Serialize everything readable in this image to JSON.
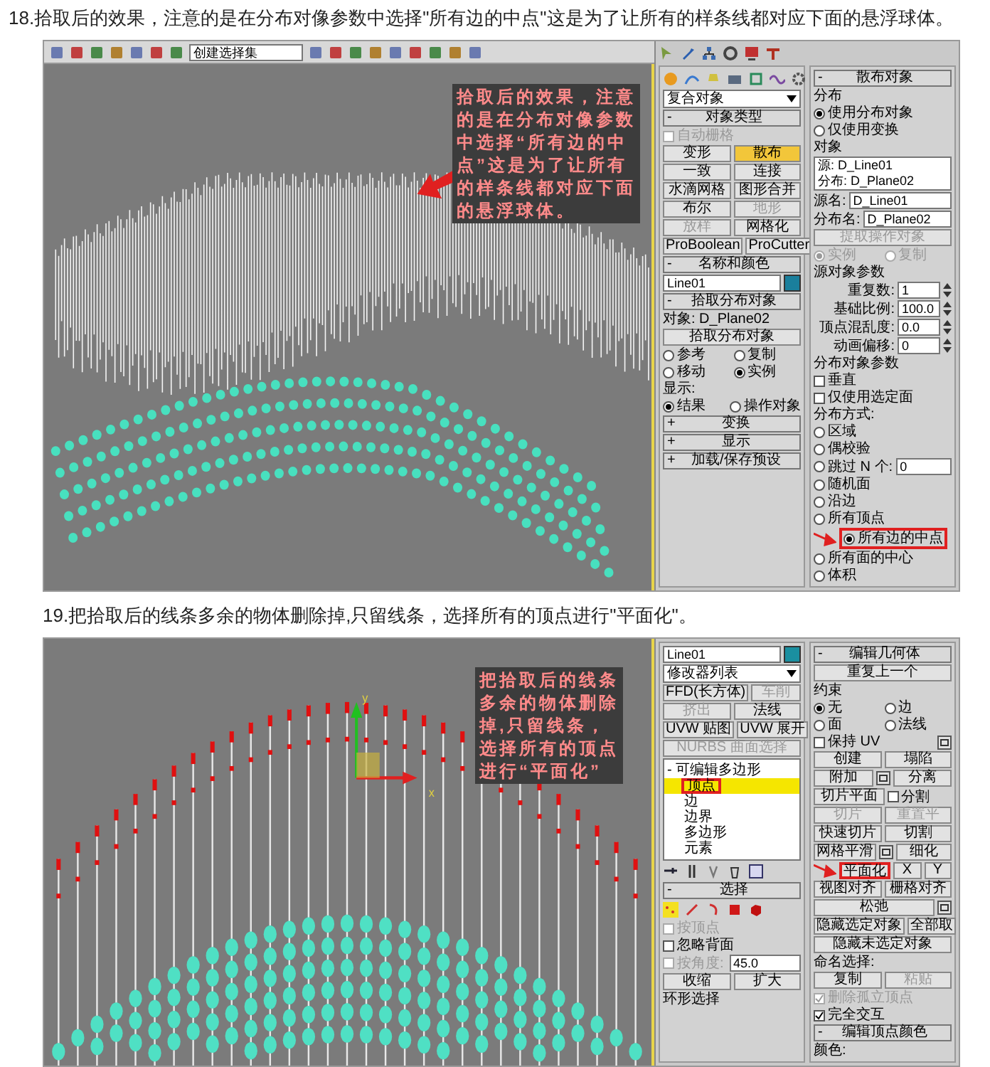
{
  "steps": [
    {
      "caption": "18.拾取后的效果，注意的是在分布对像参数中选择\"所有边的中点\"这是为了让所有的样条线都对应下面的悬浮球体。",
      "screenshot": {
        "toolbar": {
          "selection_set": "创建选择集"
        },
        "viewport": {
          "kind": "scatter",
          "annotation": [
            "拾取后的效果，注意",
            "的是在分布对像参数",
            "中选择“所有边的中",
            "点”这是为了让所有",
            "的样条线都对应下面",
            "的悬浮球体。"
          ]
        },
        "panel_top": [
          {
            "kind": "tabicons"
          }
        ],
        "columns": [
          {
            "rows": [
              [
                {
                  "kind": "createicons"
                }
              ],
              [
                {
                  "kind": "dropdown",
                  "value": "复合对象"
                }
              ],
              [
                {
                  "kind": "header",
                  "sign": "-",
                  "title": "对象类型"
                }
              ],
              [
                {
                  "kind": "check",
                  "text": "自动栅格",
                  "checked": false,
                  "disabled": true
                }
              ],
              [
                {
                  "kind": "button",
                  "text": "变形",
                  "selected": false,
                  "disabled": false
                },
                {
                  "kind": "button",
                  "text": "散布",
                  "selected": true,
                  "disabled": false
                }
              ],
              [
                {
                  "kind": "button",
                  "text": "一致",
                  "selected": false,
                  "disabled": false
                },
                {
                  "kind": "button",
                  "text": "连接",
                  "selected": false,
                  "disabled": false
                }
              ],
              [
                {
                  "kind": "button",
                  "text": "水滴网格",
                  "selected": false,
                  "disabled": false
                },
                {
                  "kind": "button",
                  "text": "图形合并",
                  "selected": false,
                  "disabled": false
                }
              ],
              [
                {
                  "kind": "button",
                  "text": "布尔",
                  "selected": false,
                  "disabled": false
                },
                {
                  "kind": "button",
                  "text": "地形",
                  "selected": false,
                  "disabled": true
                }
              ],
              [
                {
                  "kind": "button",
                  "text": "放样",
                  "selected": false,
                  "disabled": true
                },
                {
                  "kind": "button",
                  "text": "网格化",
                  "selected": false,
                  "disabled": false
                }
              ],
              [
                {
                  "kind": "button",
                  "text": "ProBoolean",
                  "selected": false,
                  "disabled": false
                },
                {
                  "kind": "button",
                  "text": "ProCutter",
                  "selected": false,
                  "disabled": false
                }
              ],
              [
                {
                  "kind": "header",
                  "sign": "-",
                  "title": "名称和颜色"
                }
              ],
              [
                {
                  "kind": "field",
                  "value": "Line01"
                },
                {
                  "kind": "swatch",
                  "color": "#1a7f9c"
                }
              ],
              [
                {
                  "kind": "header",
                  "sign": "-",
                  "title": "拾取分布对象"
                }
              ],
              [
                {
                  "kind": "label",
                  "text": "对象: D_Plane02"
                }
              ],
              [
                {
                  "kind": "button",
                  "text": "拾取分布对象",
                  "selected": false,
                  "disabled": false
                }
              ],
              [
                {
                  "kind": "radio",
                  "text": "参考",
                  "selected": false,
                  "disabled": false
                },
                {
                  "kind": "radio",
                  "text": "复制",
                  "selected": false,
                  "disabled": false
                }
              ],
              [
                {
                  "kind": "radio",
                  "text": "移动",
                  "selected": false,
                  "disabled": false
                },
                {
                  "kind": "radio",
                  "text": "实例",
                  "selected": true,
                  "disabled": false
                }
              ],
              [
                {
                  "kind": "label",
                  "text": "显示:"
                }
              ],
              [
                {
                  "kind": "radio",
                  "text": "结果",
                  "selected": true,
                  "disabled": false
                },
                {
                  "kind": "radio",
                  "text": "操作对象",
                  "selected": false,
                  "disabled": false
                }
              ],
              [
                {
                  "kind": "header",
                  "sign": "+",
                  "title": "变换"
                }
              ],
              [
                {
                  "kind": "header",
                  "sign": "+",
                  "title": "显示"
                }
              ],
              [
                {
                  "kind": "header",
                  "sign": "+",
                  "title": "加载/保存预设"
                }
              ]
            ]
          },
          {
            "rows": [
              [
                {
                  "kind": "header",
                  "sign": "-",
                  "title": "散布对象"
                }
              ],
              [
                {
                  "kind": "label",
                  "text": "分布"
                }
              ],
              [
                {
                  "kind": "radio",
                  "text": "使用分布对象",
                  "selected": true,
                  "disabled": false
                }
              ],
              [
                {
                  "kind": "radio",
                  "text": "仅使用变换",
                  "selected": false,
                  "disabled": false
                }
              ],
              [
                {
                  "kind": "label",
                  "text": "对象"
                }
              ],
              [
                {
                  "kind": "list",
                  "lines": [
                    "源: D_Line01",
                    "分布: D_Plane02"
                  ]
                }
              ],
              [
                {
                  "kind": "label",
                  "text": "源名:"
                },
                {
                  "kind": "field",
                  "value": "D_Line01"
                }
              ],
              [
                {
                  "kind": "label",
                  "text": "分布名:"
                },
                {
                  "kind": "field",
                  "value": "D_Plane02"
                }
              ],
              [
                {
                  "kind": "button",
                  "text": "提取操作对象",
                  "selected": false,
                  "disabled": true
                }
              ],
              [
                {
                  "kind": "radio",
                  "text": "实例",
                  "selected": true,
                  "disabled": true
                },
                {
                  "kind": "radio",
                  "text": "复制",
                  "selected": false,
                  "disabled": true
                }
              ],
              [
                {
                  "kind": "label",
                  "text": "源对象参数"
                }
              ],
              [
                {
                  "kind": "spinner",
                  "label": "重复数:",
                  "value": "1"
                }
              ],
              [
                {
                  "kind": "spinner",
                  "label": "基础比例:",
                  "value": "100.0"
                }
              ],
              [
                {
                  "kind": "spinner",
                  "label": "顶点混乱度:",
                  "value": "0.0"
                }
              ],
              [
                {
                  "kind": "spinner",
                  "label": "动画偏移:",
                  "value": "0"
                }
              ],
              [
                {
                  "kind": "label",
                  "text": "分布对象参数"
                }
              ],
              [
                {
                  "kind": "check",
                  "text": "垂直",
                  "checked": false,
                  "disabled": false
                }
              ],
              [
                {
                  "kind": "check",
                  "text": "仅使用选定面",
                  "checked": false,
                  "disabled": false
                }
              ],
              [
                {
                  "kind": "label",
                  "text": "分布方式:"
                }
              ],
              [
                {
                  "kind": "radio",
                  "text": "区域",
                  "selected": false,
                  "disabled": false
                }
              ],
              [
                {
                  "kind": "radio",
                  "text": "偶校验",
                  "selected": false,
                  "disabled": false
                }
              ],
              [
                {
                  "kind": "radio",
                  "text": "跳过 N 个:",
                  "selected": false,
                  "disabled": false
                },
                {
                  "kind": "field",
                  "value": "0"
                }
              ],
              [
                {
                  "kind": "radio",
                  "text": "随机面",
                  "selected": false,
                  "disabled": false
                }
              ],
              [
                {
                  "kind": "radio",
                  "text": "沿边",
                  "selected": false,
                  "disabled": false
                }
              ],
              [
                {
                  "kind": "radio",
                  "text": "所有顶点",
                  "selected": false,
                  "disabled": false
                }
              ],
              [
                {
                  "kind": "radio",
                  "text": "所有边的中点",
                  "selected": true,
                  "disabled": false,
                  "highlighted": true,
                  "pointer": true
                }
              ],
              [
                {
                  "kind": "radio",
                  "text": "所有面的中心",
                  "selected": false,
                  "disabled": false
                }
              ],
              [
                {
                  "kind": "radio",
                  "text": "体积",
                  "selected": false,
                  "disabled": false
                }
              ]
            ]
          }
        ]
      }
    },
    {
      "caption": "19.把拾取后的线条多余的物体删除掉,只留线条，选择所有的顶点进行\"平面化\"。",
      "screenshot": {
        "viewport": {
          "kind": "flatten",
          "annotation": [
            "把拾取后的线条",
            "多余的物体删除",
            "掉,只留线条，",
            "选择所有的顶点",
            "进行“平面化”"
          ],
          "gizmo_labels": [
            "y",
            "x"
          ]
        },
        "columns": [
          {
            "rows": [
              [
                {
                  "kind": "field",
                  "value": "Line01"
                },
                {
                  "kind": "swatch",
                  "color": "#1a8fa0"
                }
              ],
              [
                {
                  "kind": "dropdown",
                  "value": "修改器列表"
                }
              ],
              [
                {
                  "kind": "button",
                  "text": "FFD(长方体)",
                  "selected": false,
                  "disabled": false
                },
                {
                  "kind": "button",
                  "text": "车削",
                  "selected": false,
                  "disabled": true
                }
              ],
              [
                {
                  "kind": "button",
                  "text": "挤出",
                  "selected": false,
                  "disabled": true
                },
                {
                  "kind": "button",
                  "text": "法线",
                  "selected": false,
                  "disabled": false
                }
              ],
              [
                {
                  "kind": "button",
                  "text": "UVW 贴图",
                  "selected": false,
                  "disabled": false
                },
                {
                  "kind": "button",
                  "text": "UVW 展开",
                  "selected": false,
                  "disabled": false
                }
              ],
              [
                {
                  "kind": "button",
                  "text": "NURBS 曲面选择",
                  "selected": false,
                  "disabled": true
                }
              ],
              [
                {
                  "kind": "stack",
                  "items": [
                    {
                      "label": "可编辑多边形",
                      "sign": "-",
                      "selected": false,
                      "highlighted": false,
                      "children": [
                        {
                          "label": "顶点",
                          "selected": true,
                          "highlighted": true
                        },
                        {
                          "label": "边",
                          "selected": false,
                          "highlighted": false
                        },
                        {
                          "label": "边界",
                          "selected": false,
                          "highlighted": false
                        },
                        {
                          "label": "多边形",
                          "selected": false,
                          "highlighted": false
                        },
                        {
                          "label": "元素",
                          "selected": false,
                          "highlighted": false
                        }
                      ]
                    }
                  ]
                }
              ],
              [
                {
                  "kind": "stacktools"
                }
              ],
              [
                {
                  "kind": "header",
                  "sign": "-",
                  "title": "选择"
                }
              ],
              [
                {
                  "kind": "subobjects"
                }
              ],
              [
                {
                  "kind": "check",
                  "text": "按顶点",
                  "checked": false,
                  "disabled": true
                }
              ],
              [
                {
                  "kind": "check",
                  "text": "忽略背面",
                  "checked": false,
                  "disabled": false
                }
              ],
              [
                {
                  "kind": "check",
                  "text": "按角度:",
                  "checked": false,
                  "disabled": true
                },
                {
                  "kind": "field",
                  "value": "45.0"
                }
              ],
              [
                {
                  "kind": "button",
                  "text": "收缩",
                  "selected": false,
                  "disabled": false
                },
                {
                  "kind": "button",
                  "text": "扩大",
                  "selected": false,
                  "disabled": false
                }
              ],
              [
                {
                  "kind": "label",
                  "text": "环形选择"
                }
              ]
            ]
          },
          {
            "rows": [
              [
                {
                  "kind": "header",
                  "sign": "-",
                  "title": "编辑几何体"
                }
              ],
              [
                {
                  "kind": "button",
                  "text": "重复上一个",
                  "selected": false,
                  "disabled": false
                }
              ],
              [
                {
                  "kind": "label",
                  "text": "约束"
                }
              ],
              [
                {
                  "kind": "radio",
                  "text": "无",
                  "selected": true,
                  "disabled": false
                },
                {
                  "kind": "radio",
                  "text": "边",
                  "selected": false,
                  "disabled": false
                }
              ],
              [
                {
                  "kind": "radio",
                  "text": "面",
                  "selected": false,
                  "disabled": false
                },
                {
                  "kind": "radio",
                  "text": "法线",
                  "selected": false,
                  "disabled": false
                }
              ],
              [
                {
                  "kind": "check",
                  "text": "保持 UV",
                  "checked": false,
                  "disabled": false
                },
                {
                  "kind": "settings"
                }
              ],
              [
                {
                  "kind": "button",
                  "text": "创建",
                  "selected": false,
                  "disabled": false
                },
                {
                  "kind": "button",
                  "text": "塌陷",
                  "selected": false,
                  "disabled": false
                }
              ],
              [
                {
                  "kind": "button",
                  "text": "附加",
                  "selected": false,
                  "disabled": false
                },
                {
                  "kind": "settings"
                },
                {
                  "kind": "button",
                  "text": "分离",
                  "selected": false,
                  "disabled": false
                }
              ],
              [
                {
                  "kind": "button",
                  "text": "切片平面",
                  "selected": false,
                  "disabled": false
                },
                {
                  "kind": "check",
                  "text": "分割",
                  "checked": false,
                  "disabled": false
                }
              ],
              [
                {
                  "kind": "button",
                  "text": "切片",
                  "selected": false,
                  "disabled": true
                },
                {
                  "kind": "button",
                  "text": "重置平",
                  "selected": false,
                  "disabled": true
                }
              ],
              [
                {
                  "kind": "button",
                  "text": "快速切片",
                  "selected": false,
                  "disabled": false
                },
                {
                  "kind": "button",
                  "text": "切割",
                  "selected": false,
                  "disabled": false
                }
              ],
              [
                {
                  "kind": "button",
                  "text": "网格平滑",
                  "selected": false,
                  "disabled": false
                },
                {
                  "kind": "settings"
                },
                {
                  "kind": "button",
                  "text": "细化",
                  "selected": false,
                  "disabled": false
                }
              ],
              [
                {
                  "kind": "button",
                  "text": "平面化",
                  "selected": false,
                  "disabled": false,
                  "highlighted": true,
                  "pointer": true
                },
                {
                  "kind": "button",
                  "text": "X",
                  "selected": false,
                  "disabled": false
                },
                {
                  "kind": "button",
                  "text": "Y",
                  "selected": false,
                  "disabled": false
                }
              ],
              [
                {
                  "kind": "button",
                  "text": "视图对齐",
                  "selected": false,
                  "disabled": false
                },
                {
                  "kind": "button",
                  "text": "栅格对齐",
                  "selected": false,
                  "disabled": false
                }
              ],
              [
                {
                  "kind": "button",
                  "text": "松弛",
                  "selected": false,
                  "disabled": false
                },
                {
                  "kind": "settings"
                }
              ],
              [
                {
                  "kind": "button",
                  "text": "隐藏选定对象",
                  "selected": false,
                  "disabled": false
                },
                {
                  "kind": "button",
                  "text": "全部取",
                  "selected": false,
                  "disabled": false
                }
              ],
              [
                {
                  "kind": "button",
                  "text": "隐藏未选定对象",
                  "selected": false,
                  "disabled": false
                }
              ],
              [
                {
                  "kind": "label",
                  "text": "命名选择:"
                }
              ],
              [
                {
                  "kind": "button",
                  "text": "复制",
                  "selected": false,
                  "disabled": false
                },
                {
                  "kind": "button",
                  "text": "粘贴",
                  "selected": false,
                  "disabled": true
                }
              ],
              [
                {
                  "kind": "check",
                  "text": "删除孤立顶点",
                  "checked": true,
                  "disabled": true
                }
              ],
              [
                {
                  "kind": "check",
                  "text": "完全交互",
                  "checked": true,
                  "disabled": false
                }
              ],
              [
                {
                  "kind": "header",
                  "sign": "-",
                  "title": "编辑顶点颜色"
                }
              ],
              [
                {
                  "kind": "label",
                  "text": "颜色:"
                }
              ]
            ]
          }
        ]
      }
    }
  ]
}
